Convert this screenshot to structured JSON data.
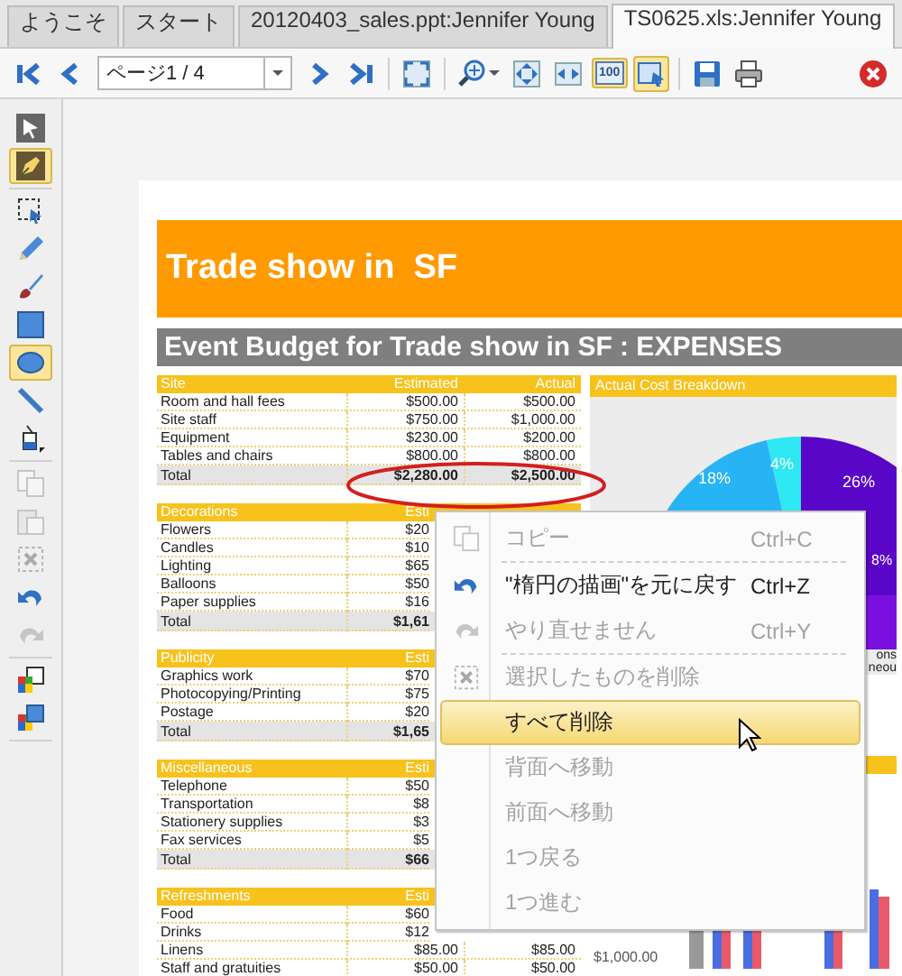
{
  "tabs": [
    {
      "label": "ようこそ",
      "selected": false
    },
    {
      "label": "スタート",
      "selected": false
    },
    {
      "label": "20120403_sales.ppt:Jennifer Young",
      "selected": false
    },
    {
      "label": "TS0625.xls:Jennifer Young",
      "selected": true
    }
  ],
  "toolbar": {
    "groups": [
      [
        {
          "kind": "first",
          "selected": false
        },
        {
          "kind": "prev",
          "selected": false
        },
        {
          "kind": "page-field",
          "value": "ページ1 / 4"
        },
        {
          "kind": "next",
          "selected": false
        },
        {
          "kind": "last",
          "selected": false
        }
      ],
      [
        {
          "kind": "fit",
          "selected": false
        }
      ],
      [
        {
          "kind": "zoom",
          "selected": false
        },
        {
          "kind": "fit-page",
          "selected": false
        },
        {
          "kind": "fit-width",
          "selected": false
        },
        {
          "kind": "actual-size",
          "label": "100",
          "selected": true
        },
        {
          "kind": "annotate",
          "selected": true
        }
      ],
      [
        {
          "kind": "save",
          "selected": false
        },
        {
          "kind": "print",
          "selected": false
        }
      ]
    ]
  },
  "tools": {
    "groups": [
      [
        {
          "kind": "pointer",
          "selected": false,
          "disabled": false
        },
        {
          "kind": "pen",
          "selected": true,
          "disabled": false
        }
      ],
      [
        {
          "kind": "select",
          "selected": false,
          "disabled": false
        },
        {
          "kind": "pencil",
          "selected": false,
          "disabled": false
        },
        {
          "kind": "brush",
          "selected": false,
          "disabled": false
        },
        {
          "kind": "rectangle",
          "selected": false,
          "disabled": false
        },
        {
          "kind": "ellipse",
          "selected": true,
          "disabled": false
        },
        {
          "kind": "line",
          "selected": false,
          "disabled": false
        },
        {
          "kind": "fill",
          "selected": false,
          "disabled": false
        }
      ],
      [
        {
          "kind": "copy",
          "selected": false,
          "disabled": true
        },
        {
          "kind": "paste",
          "selected": false,
          "disabled": true
        },
        {
          "kind": "delete",
          "selected": false,
          "disabled": true
        },
        {
          "kind": "undo",
          "selected": false,
          "disabled": false
        },
        {
          "kind": "redo",
          "selected": false,
          "disabled": true
        }
      ],
      [
        {
          "kind": "back",
          "selected": false,
          "disabled": false
        },
        {
          "kind": "front",
          "selected": false,
          "disabled": false
        }
      ]
    ]
  },
  "document": {
    "title": "Trade show in  SF",
    "subtitle": "Event Budget for Trade show in SF : EXPENSES",
    "sections": [
      {
        "name": "Site",
        "columns": [
          "Estimated",
          "Actual"
        ],
        "rows": [
          {
            "label": "Room and hall fees",
            "values": [
              "$500.00",
              "$500.00"
            ]
          },
          {
            "label": "Site staff",
            "values": [
              "$750.00",
              "$1,000.00"
            ]
          },
          {
            "label": "Equipment",
            "values": [
              "$230.00",
              "$200.00"
            ]
          },
          {
            "label": "Tables and chairs",
            "values": [
              "$800.00",
              "$800.00"
            ]
          }
        ],
        "total": {
          "label": "Total",
          "values": [
            "$2,280.00",
            "$2,500.00"
          ]
        }
      },
      {
        "name": "Decorations",
        "columns": [
          "Esti"
        ],
        "rows": [
          {
            "label": "Flowers",
            "values": [
              "$20"
            ]
          },
          {
            "label": "Candles",
            "values": [
              "$10"
            ]
          },
          {
            "label": "Lighting",
            "values": [
              "$65"
            ]
          },
          {
            "label": "Balloons",
            "values": [
              "$50"
            ]
          },
          {
            "label": "Paper supplies",
            "values": [
              "$16"
            ]
          }
        ],
        "total": {
          "label": "Total",
          "values": [
            "$1,61"
          ]
        }
      },
      {
        "name": "Publicity",
        "columns": [
          "Esti"
        ],
        "rows": [
          {
            "label": "Graphics work",
            "values": [
              "$70"
            ]
          },
          {
            "label": "Photocopying/Printing",
            "values": [
              "$75"
            ]
          },
          {
            "label": "Postage",
            "values": [
              "$20"
            ]
          }
        ],
        "total": {
          "label": "Total",
          "values": [
            "$1,65"
          ]
        }
      },
      {
        "name": "Miscellaneous",
        "columns": [
          "Esti"
        ],
        "rows": [
          {
            "label": "Telephone",
            "values": [
              "$50"
            ]
          },
          {
            "label": "Transportation",
            "values": [
              "$8"
            ]
          },
          {
            "label": "Stationery supplies",
            "values": [
              "$3"
            ]
          },
          {
            "label": "Fax services",
            "values": [
              "$5"
            ]
          }
        ],
        "total": {
          "label": "Total",
          "values": [
            "$66"
          ]
        }
      },
      {
        "name": "Refreshments",
        "columns": [
          "Esti"
        ],
        "rows": [
          {
            "label": "Food",
            "values": [
              "$60"
            ]
          },
          {
            "label": "Drinks",
            "values": [
              "$12"
            ]
          },
          {
            "label": "Linens",
            "values": [
              "$85.00",
              "$85.00"
            ]
          },
          {
            "label": "Staff and gratuities",
            "values": [
              "$50.00",
              "$50.00"
            ]
          }
        ]
      }
    ],
    "chart_panel": {
      "title": "Actual Cost Breakdown",
      "slice_labels": [
        "18%",
        "4%",
        "26%",
        "8%"
      ],
      "legend": [
        "ons",
        "neou"
      ],
      "tick_label": "$1,000.00"
    },
    "annotation": {
      "kind": "ellipse"
    }
  },
  "context_menu": {
    "items": [
      {
        "label": "コピー",
        "shortcut": "Ctrl+C",
        "kind": "copy",
        "disabled": true,
        "selected": false,
        "separator_after": true
      },
      {
        "label": "\"楕円の描画\"を元に戻す",
        "shortcut": "Ctrl+Z",
        "kind": "undo",
        "disabled": false,
        "selected": false,
        "separator_after": false
      },
      {
        "label": "やり直せません",
        "shortcut": "Ctrl+Y",
        "kind": "redo",
        "disabled": true,
        "selected": false,
        "separator_after": true
      },
      {
        "label": "選択したものを削除",
        "kind": "delete",
        "disabled": true,
        "selected": false,
        "separator_after": false
      },
      {
        "label": "すべて削除",
        "disabled": false,
        "selected": true,
        "separator_after": false
      },
      {
        "label": "背面へ移動",
        "disabled": true,
        "selected": false,
        "separator_after": false
      },
      {
        "label": "前面へ移動",
        "disabled": true,
        "selected": false,
        "separator_after": false
      },
      {
        "label": "1つ戻る",
        "disabled": true,
        "selected": false,
        "separator_after": false
      },
      {
        "label": "1つ進む",
        "disabled": true,
        "selected": false,
        "separator_after": false
      }
    ]
  }
}
